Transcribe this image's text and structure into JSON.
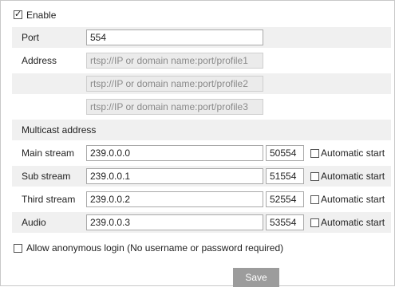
{
  "enable": {
    "label": "Enable",
    "checked": true
  },
  "port": {
    "label": "Port",
    "value": "554"
  },
  "address": {
    "label": "Address",
    "placeholders": [
      "rtsp://IP or domain name:port/profile1",
      "rtsp://IP or domain name:port/profile2",
      "rtsp://IP or domain name:port/profile3"
    ]
  },
  "multicast": {
    "heading": "Multicast address",
    "auto_label": "Automatic start",
    "streams": [
      {
        "label": "Main stream",
        "ip": "239.0.0.0",
        "port": "50554",
        "auto": false
      },
      {
        "label": "Sub stream",
        "ip": "239.0.0.1",
        "port": "51554",
        "auto": false
      },
      {
        "label": "Third stream",
        "ip": "239.0.0.2",
        "port": "52554",
        "auto": false
      },
      {
        "label": "Audio",
        "ip": "239.0.0.3",
        "port": "53554",
        "auto": false
      }
    ]
  },
  "anonymous": {
    "label": "Allow anonymous login (No username or password required)",
    "checked": false
  },
  "save_label": "Save"
}
